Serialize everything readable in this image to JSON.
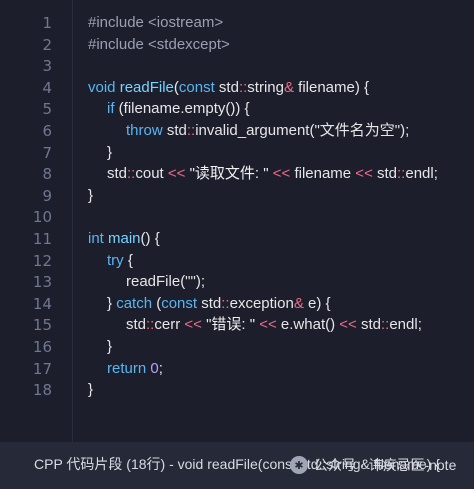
{
  "code_lines": [
    {
      "n": "1",
      "parts": [
        "#include <iostream>"
      ]
    },
    {
      "n": "2",
      "parts": [
        "#include <stdexcept>"
      ]
    },
    {
      "n": "3",
      "parts": []
    },
    {
      "n": "4",
      "parts": [
        "void",
        " ",
        "readFile",
        "(",
        "const",
        " std",
        "::",
        "string",
        "&",
        " filename) {"
      ]
    },
    {
      "n": "5",
      "parts": [
        "if",
        " (filename.empty()) {"
      ]
    },
    {
      "n": "6",
      "parts": [
        "throw",
        " std",
        "::",
        "invalid_argument(\"文件名为空\");"
      ]
    },
    {
      "n": "7",
      "parts": [
        "}"
      ]
    },
    {
      "n": "8",
      "parts": [
        "std",
        "::",
        "cout",
        " << ",
        "\"读取文件: \"",
        " << ",
        "filename",
        " << ",
        "std",
        "::",
        "endl;"
      ]
    },
    {
      "n": "9",
      "parts": [
        "}"
      ]
    },
    {
      "n": "10",
      "parts": []
    },
    {
      "n": "11",
      "parts": [
        "int",
        " ",
        "main",
        "() {"
      ]
    },
    {
      "n": "12",
      "parts": [
        "try",
        " {"
      ]
    },
    {
      "n": "13",
      "parts": [
        "readFile(\"\");"
      ]
    },
    {
      "n": "14",
      "parts": [
        "} ",
        "catch",
        " (",
        "const",
        " std",
        "::",
        "exception",
        "&",
        " e) {"
      ]
    },
    {
      "n": "15",
      "parts": [
        "std",
        "::",
        "cerr",
        " << ",
        "\"错误: \"",
        " << ",
        "e.what()",
        " << ",
        "std",
        "::",
        "endl;"
      ]
    },
    {
      "n": "16",
      "parts": [
        "}"
      ]
    },
    {
      "n": "17",
      "parts": [
        "return",
        " ",
        "0",
        ";"
      ]
    },
    {
      "n": "18",
      "parts": [
        "}"
      ]
    }
  ],
  "footer": {
    "title": "CPP 代码片段 (18行) - void readFile(const std::string& filename) {",
    "watermark": "公众号 · 讳疾忌医-note"
  },
  "colors": {
    "keyword": "#59b6f0",
    "function": "#79d3ff",
    "operator": "#f06b8a",
    "number": "#b4a2ff",
    "background": "#1c1e2b"
  }
}
